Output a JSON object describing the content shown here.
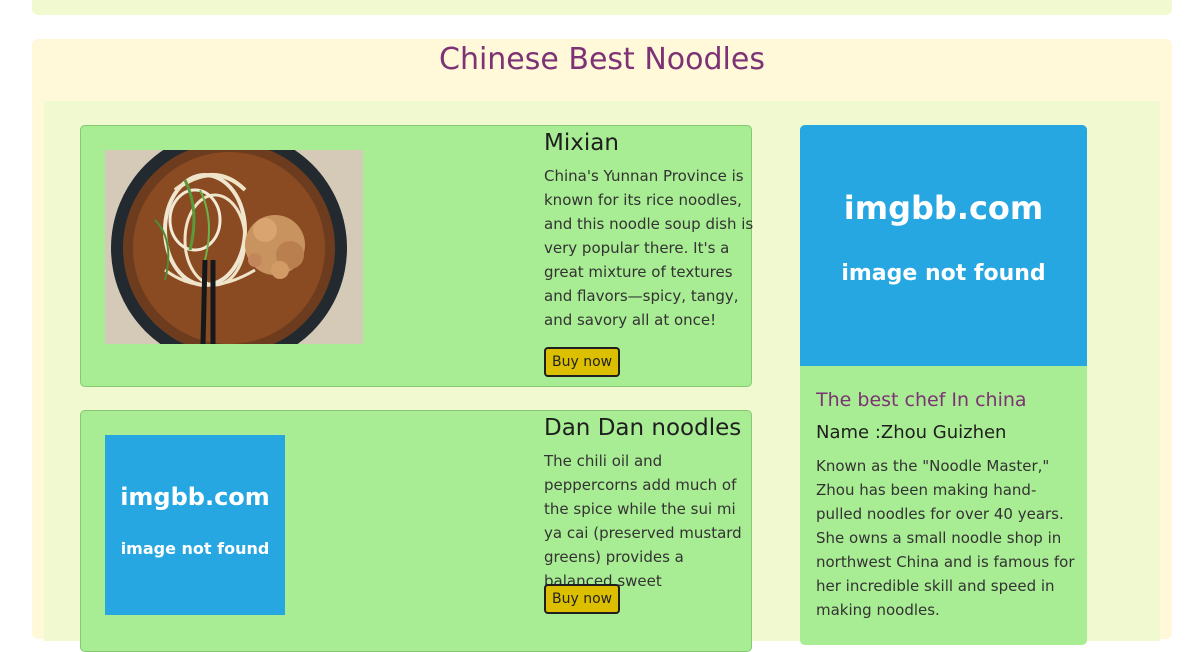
{
  "section": {
    "title": "Chinese Best Noodles"
  },
  "noodles": [
    {
      "name": "Mixian",
      "description": "China's Yunnan Province is known for its rice noodles, and this noodle soup dish is very popular there. It's a great mixture of textures and flavors—spicy, tangy, and savory all at once!",
      "button_label": "Buy now"
    },
    {
      "name": "Dan Dan noodles",
      "description": "The chili oil and peppercorns add much of the spice while the sui mi ya cai (preserved mustard greens) provides a balanced sweet",
      "button_label": "Buy now",
      "image_placeholder": {
        "title": "imgbb.com",
        "subtitle": "image not found"
      }
    }
  ],
  "chef": {
    "image_placeholder": {
      "title": "imgbb.com",
      "subtitle": "image not found"
    },
    "subtitle": "The best chef In china",
    "name": "Name :Zhou Guizhen",
    "bio": "Known as the \"Noodle Master,\" Zhou has been making hand-pulled noodles for over 40 years. She owns a small noodle shop in northwest China and is famous for her incredible skill and speed in making noodles."
  },
  "colors": {
    "title": "#7d3275",
    "card_bg": "#a8ec93",
    "button": "#dcc000",
    "placeholder": "#26a7e1",
    "section_bg": "#fff8d9",
    "inner_bg": "#f0f9cf"
  }
}
